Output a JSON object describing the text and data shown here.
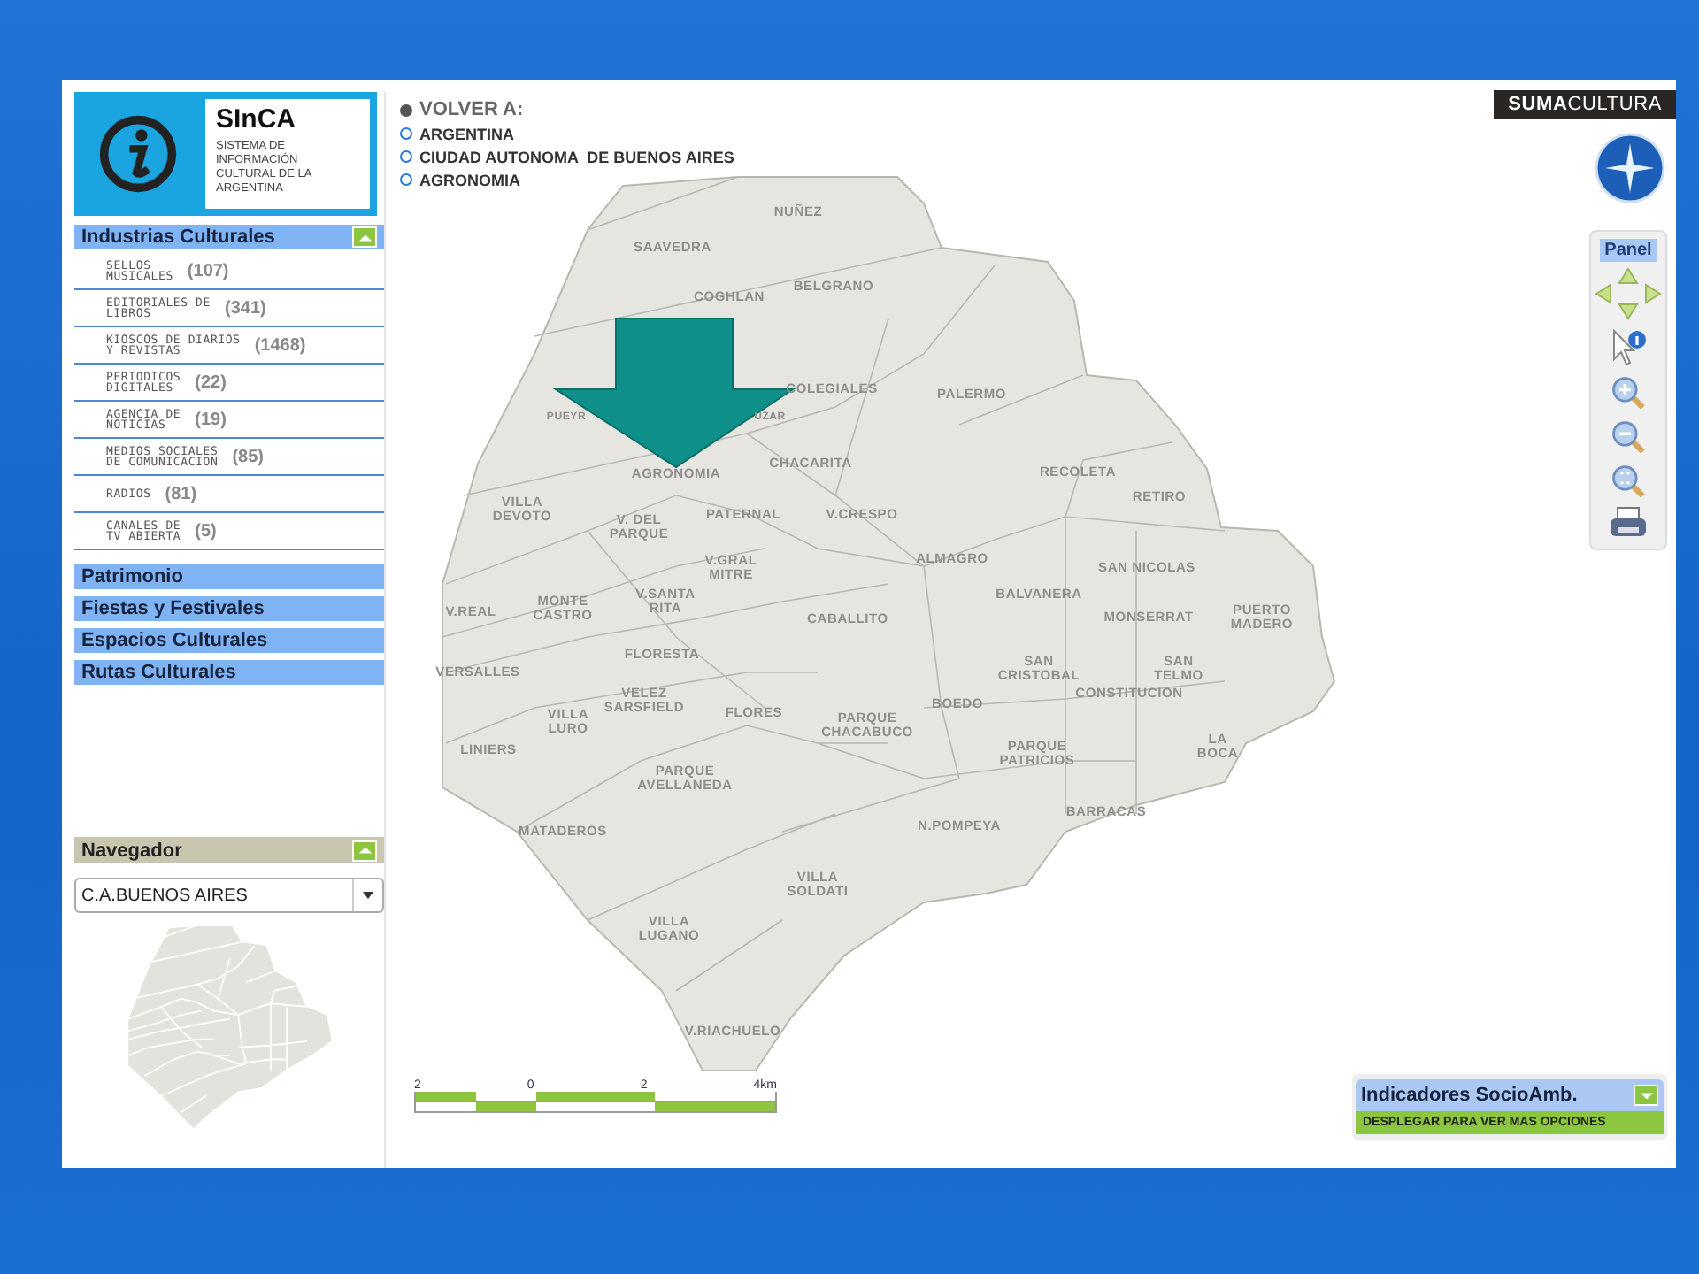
{
  "logo": {
    "title": "SInCA",
    "subtitle": "SISTEMA DE INFORMACIÓN CULTURAL DE LA ARGENTINA"
  },
  "categories": [
    {
      "label": "Industrias Culturales",
      "expanded": true,
      "items": [
        {
          "label": "SELLOS\nMUSICALES",
          "count": "(107)"
        },
        {
          "label": "EDITORIALES DE\nLIBROS",
          "count": "(341)"
        },
        {
          "label": "KIOSCOS DE DIARIOS\nY REVISTAS",
          "count": "(1468)"
        },
        {
          "label": "PERIODICOS\nDIGITALES",
          "count": "(22)"
        },
        {
          "label": "AGENCIA DE\nNOTICIAS",
          "count": "(19)"
        },
        {
          "label": "MEDIOS SOCIALES\nDE COMUNICACION",
          "count": "(85)"
        },
        {
          "label": "RADIOS",
          "count": "(81)"
        },
        {
          "label": "CANALES DE\nTV ABIERTA",
          "count": "(5)"
        }
      ]
    },
    {
      "label": "Patrimonio"
    },
    {
      "label": "Fiestas y Festivales"
    },
    {
      "label": "Espacios Culturales"
    },
    {
      "label": "Rutas Culturales"
    }
  ],
  "navigator": {
    "title": "Navegador",
    "expanded": true,
    "select_value": "C.A.BUENOS AIRES"
  },
  "breadcrumb": {
    "title": "VOLVER A:",
    "items": [
      "ARGENTINA",
      "CIUDAD AUTONOMA  DE BUENOS AIRES",
      "AGRONOMIA"
    ]
  },
  "brand": {
    "bold": "SUMA",
    "rest": "CULTURA"
  },
  "panel": {
    "title": "Panel"
  },
  "map": {
    "districts": [
      "NUÑEZ",
      "SAAVEDRA",
      "COGHLAN",
      "BELGRANO",
      "COLEGIALES",
      "PALERMO",
      "PUEYR",
      "UZAR",
      "AGRONOMIA",
      "CHACARITA",
      "RECOLETA",
      "VILLA\nDEVOTO",
      "V. DEL\nPARQUE",
      "PATERNAL",
      "V.CRESPO",
      "RETIRO",
      "V.GRAL\nMITRE",
      "ALMAGRO",
      "SAN NICOLAS",
      "V.REAL",
      "MONTE\nCASTRO",
      "V.SANTA\nRITA",
      "CABALLITO",
      "BALVANERA",
      "MONSERRAT",
      "PUERTO\nMADERO",
      "VERSALLES",
      "FLORESTA",
      "SAN\nCRISTOBAL",
      "SAN\nTELMO",
      "VILLA\nLURO",
      "VELEZ\nSARSFIELD",
      "FLORES",
      "PARQUE\nCHACABUCO",
      "BOEDO",
      "CONSTITUCION",
      "LINIERS",
      "PARQUE\nAVELLANEDA",
      "PARQUE\nPATRICIOS",
      "LA\nBOCA",
      "MATADEROS",
      "N.POMPEYA",
      "BARRACAS",
      "VILLA\nSOLDATI",
      "VILLA\nLUGANO",
      "V.RIACHUELO"
    ]
  },
  "scale_bar": {
    "ticks": [
      "2",
      "0",
      "2",
      "4km"
    ]
  },
  "indicators": {
    "title": "Indicadores SocioAmb.",
    "expanded": false,
    "action": "DESPLEGAR PARA VER MAS OPCIONES"
  }
}
